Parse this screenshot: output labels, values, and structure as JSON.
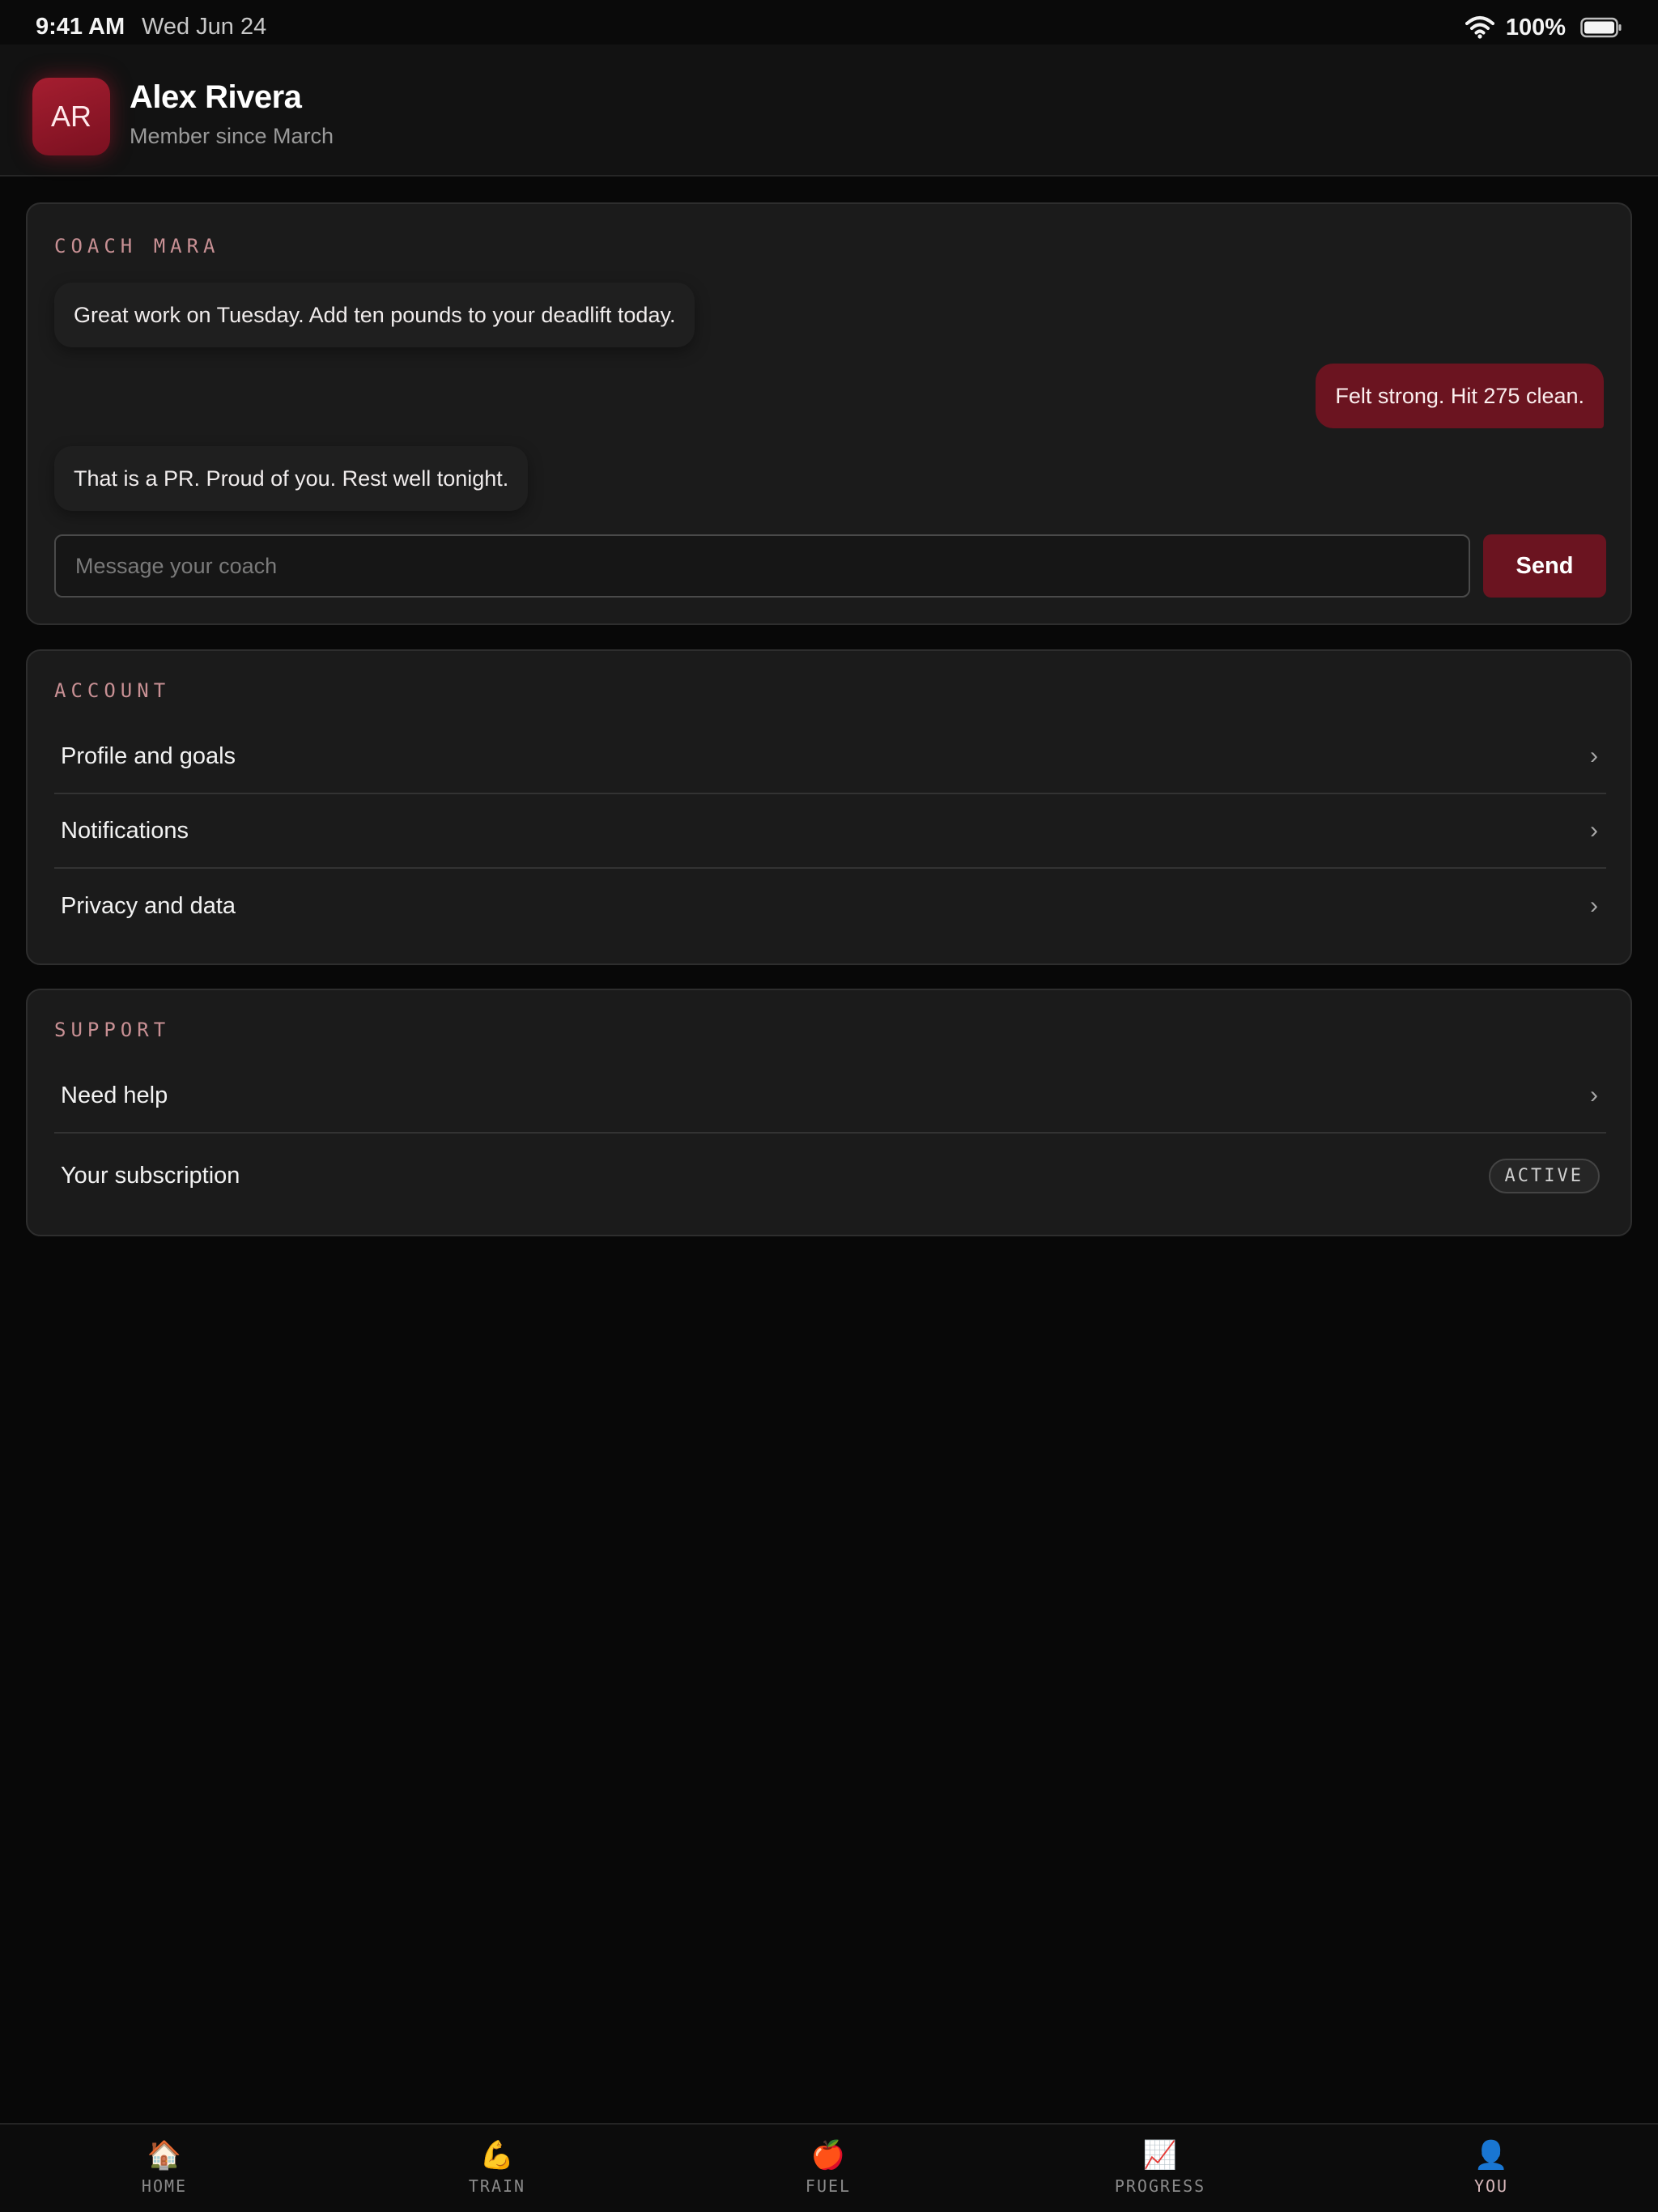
{
  "status_bar": {
    "time": "9:41 AM",
    "date": "Wed Jun 24",
    "battery": "100%"
  },
  "profile": {
    "initials": "AR",
    "name": "Alex Rivera",
    "subtitle": "Member since March"
  },
  "coach": {
    "title": "COACH MARA",
    "messages": [
      {
        "from": "coach",
        "text": "Great work on Tuesday. Add ten pounds to your deadlift today."
      },
      {
        "from": "user",
        "text": "Felt strong. Hit 275 clean."
      },
      {
        "from": "coach",
        "text": "That is a PR. Proud of you. Rest well tonight."
      }
    ],
    "input_placeholder": "Message your coach",
    "input_value": "",
    "send_label": "Send"
  },
  "account": {
    "title": "ACCOUNT",
    "items": [
      {
        "label": "Profile and goals"
      },
      {
        "label": "Notifications"
      },
      {
        "label": "Privacy and data"
      }
    ]
  },
  "support": {
    "title": "SUPPORT",
    "items": [
      {
        "label": "Need help"
      },
      {
        "label": "Your subscription",
        "badge": "ACTIVE"
      }
    ]
  },
  "tabs": [
    {
      "label": "HOME",
      "icon": "🏠",
      "icon_name": "home-icon"
    },
    {
      "label": "TRAIN",
      "icon": "💪",
      "icon_name": "flexed-biceps-icon"
    },
    {
      "label": "FUEL",
      "icon": "🍎",
      "icon_name": "apple-icon"
    },
    {
      "label": "PROGRESS",
      "icon": "📈",
      "icon_name": "chart-increasing-icon"
    },
    {
      "label": "YOU",
      "icon": "👤",
      "icon_name": "person-icon",
      "active": true
    }
  ],
  "colors": {
    "accent": "#6b1420",
    "avatar": "#a51e30",
    "section_title": "#c89094",
    "background": "#080808",
    "card": "#1b1b1b"
  }
}
